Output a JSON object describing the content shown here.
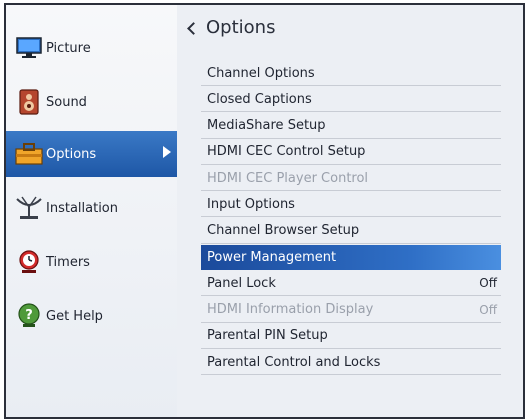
{
  "sidebar": {
    "items": [
      {
        "label": "Picture"
      },
      {
        "label": "Sound"
      },
      {
        "label": "Options"
      },
      {
        "label": "Installation"
      },
      {
        "label": "Timers"
      },
      {
        "label": "Get Help"
      }
    ]
  },
  "main": {
    "title": "Options",
    "items": [
      {
        "label": "Channel Options"
      },
      {
        "label": "Closed Captions"
      },
      {
        "label": "MediaShare Setup"
      },
      {
        "label": "HDMI CEC Control Setup"
      },
      {
        "label": "HDMI CEC Player Control"
      },
      {
        "label": "Input Options"
      },
      {
        "label": "Channel Browser Setup"
      },
      {
        "label": "Power Management"
      },
      {
        "label": "Panel Lock",
        "value": "Off"
      },
      {
        "label": "HDMI Information Display",
        "value": "Off"
      },
      {
        "label": "Parental PIN Setup"
      },
      {
        "label": "Parental Control and Locks"
      }
    ]
  },
  "colors": {
    "accent_blue": "#2f6fc6",
    "frame_dark": "#2b2f3a",
    "disabled_text": "#9aa0ab"
  },
  "icons": {
    "picture": "monitor-icon",
    "sound": "speaker-icon",
    "options": "toolbox-icon",
    "installation": "satellite-antenna-icon",
    "timers": "alarm-clock-icon",
    "help": "help-question-icon"
  }
}
